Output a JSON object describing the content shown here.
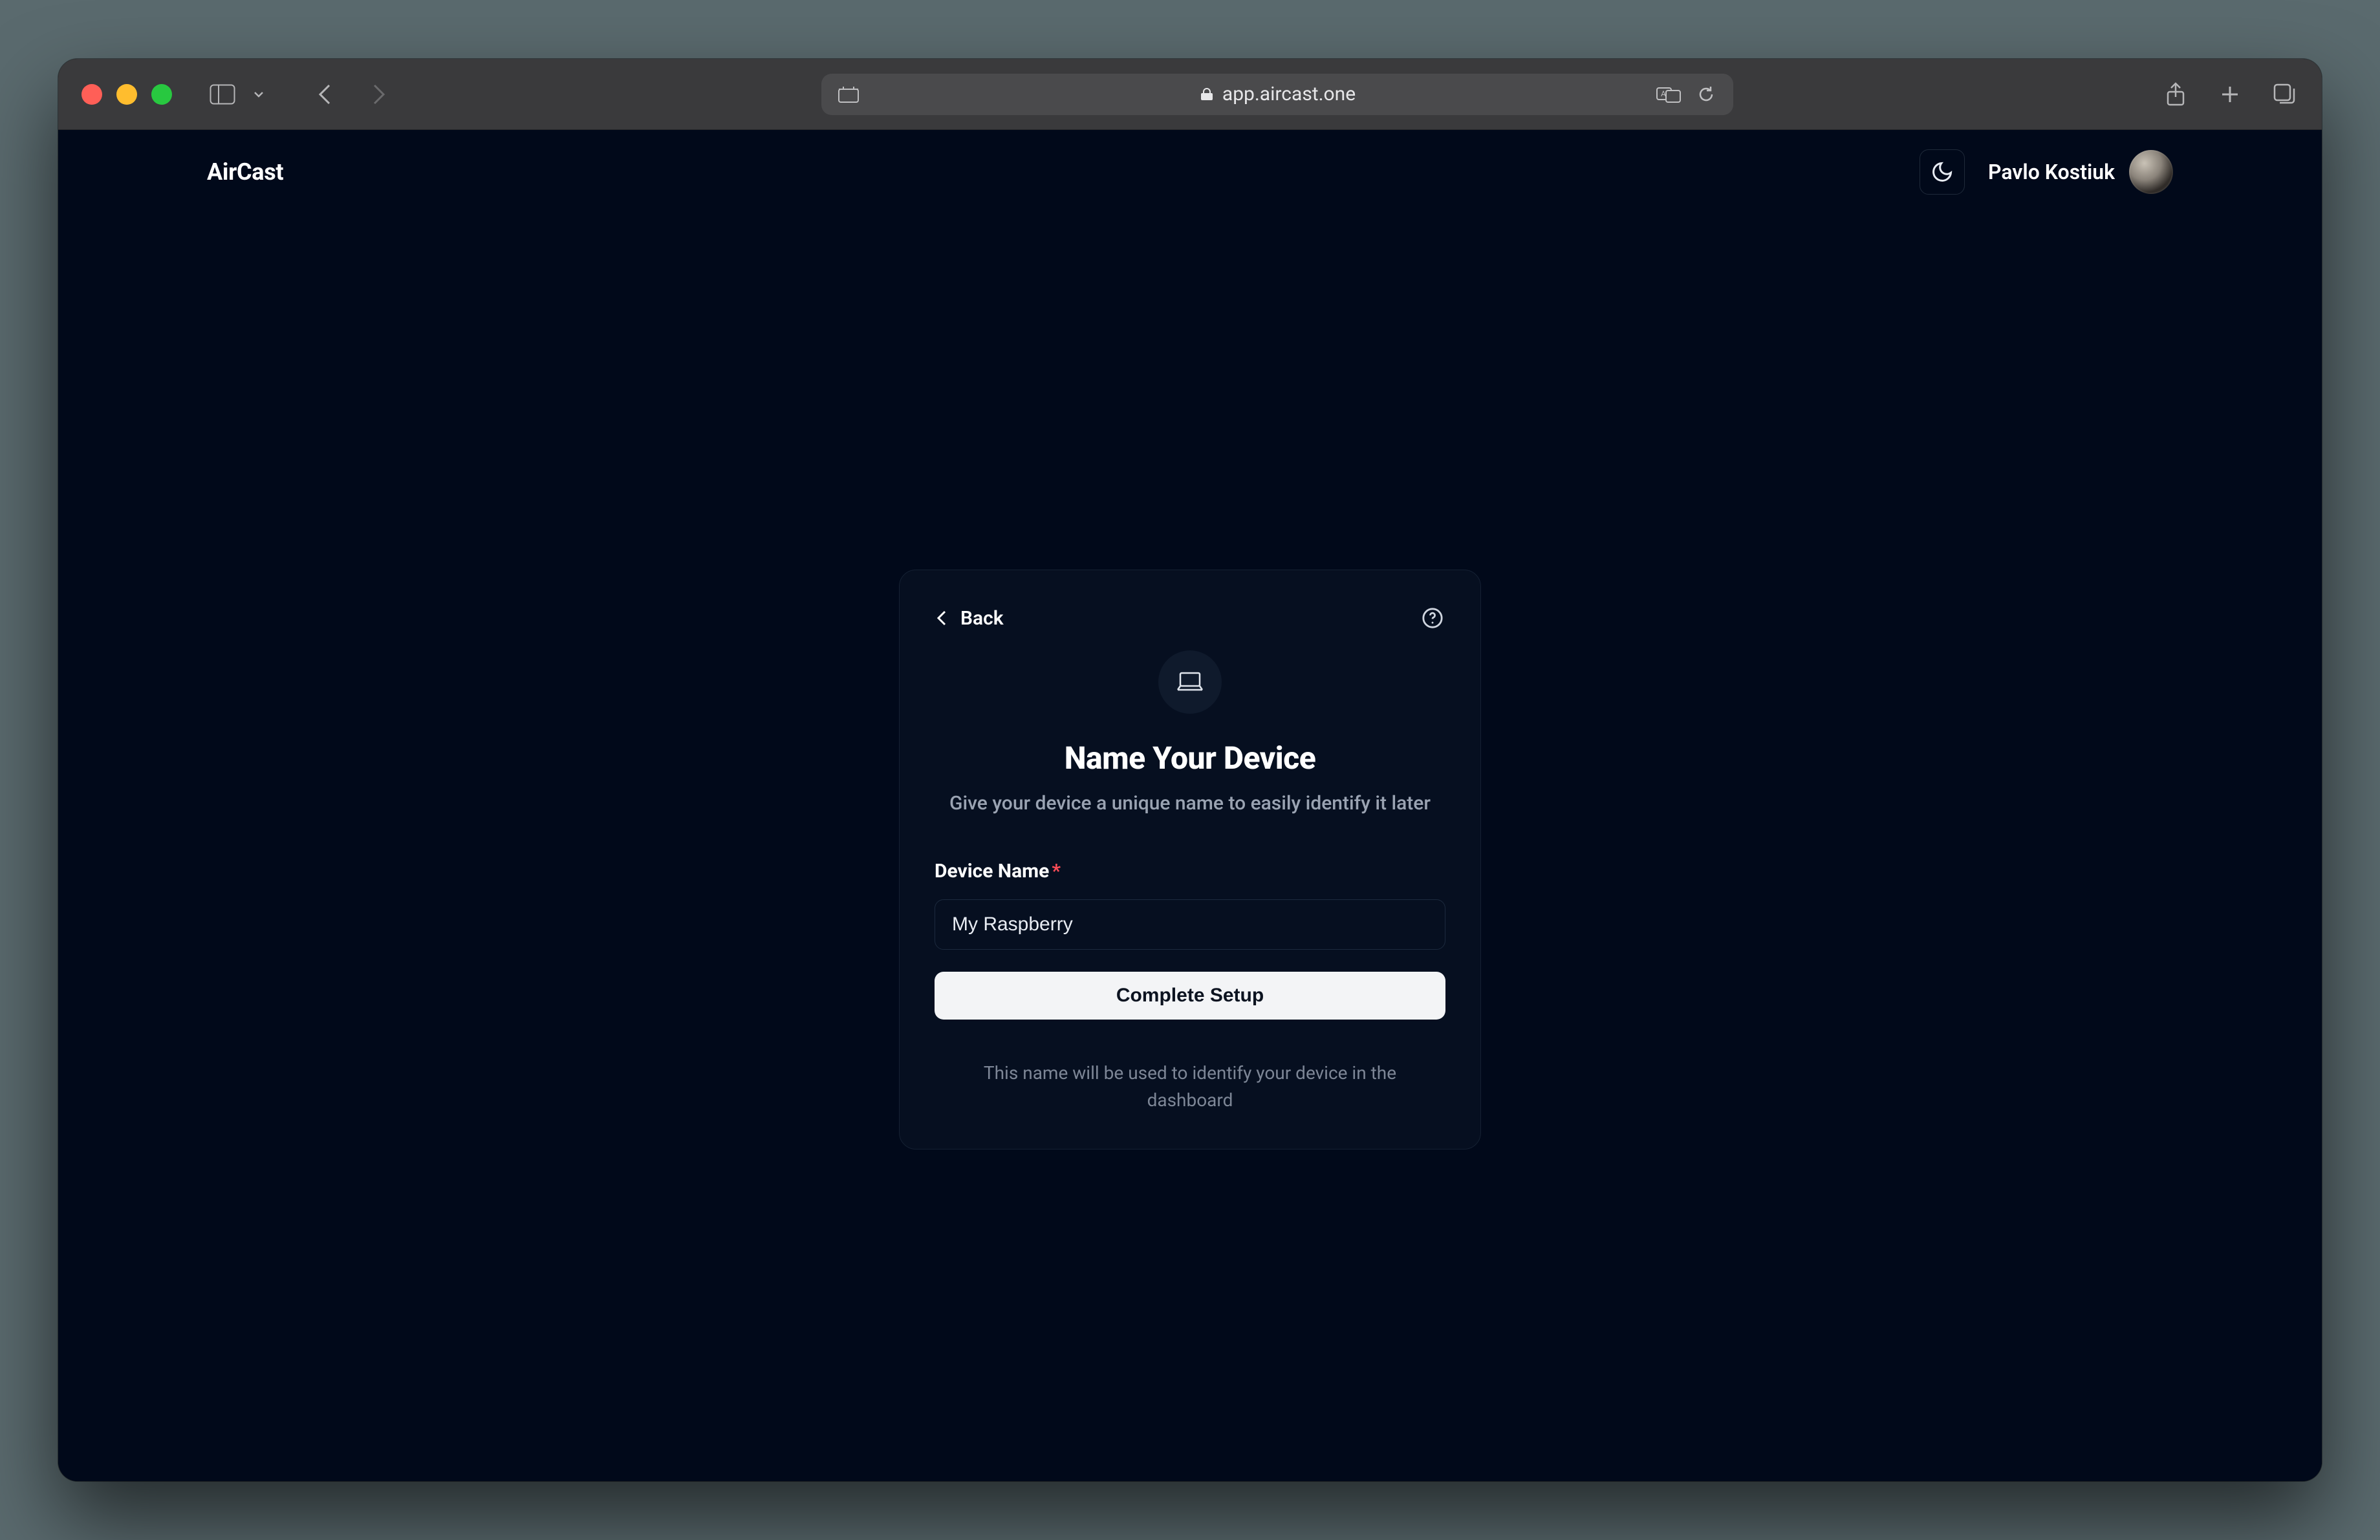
{
  "browser": {
    "url_host": "app.aircast.one"
  },
  "header": {
    "brand": "AirCast",
    "user_name": "Pavlo Kostiuk"
  },
  "card": {
    "back_label": "Back",
    "title": "Name Your Device",
    "subtitle": "Give your device a unique name to easily identify it later",
    "field_label": "Device Name",
    "required_mark": "*",
    "input_value": "My Raspberry",
    "submit_label": "Complete Setup",
    "hint": "This name will be used to identify your device in the dashboard"
  }
}
